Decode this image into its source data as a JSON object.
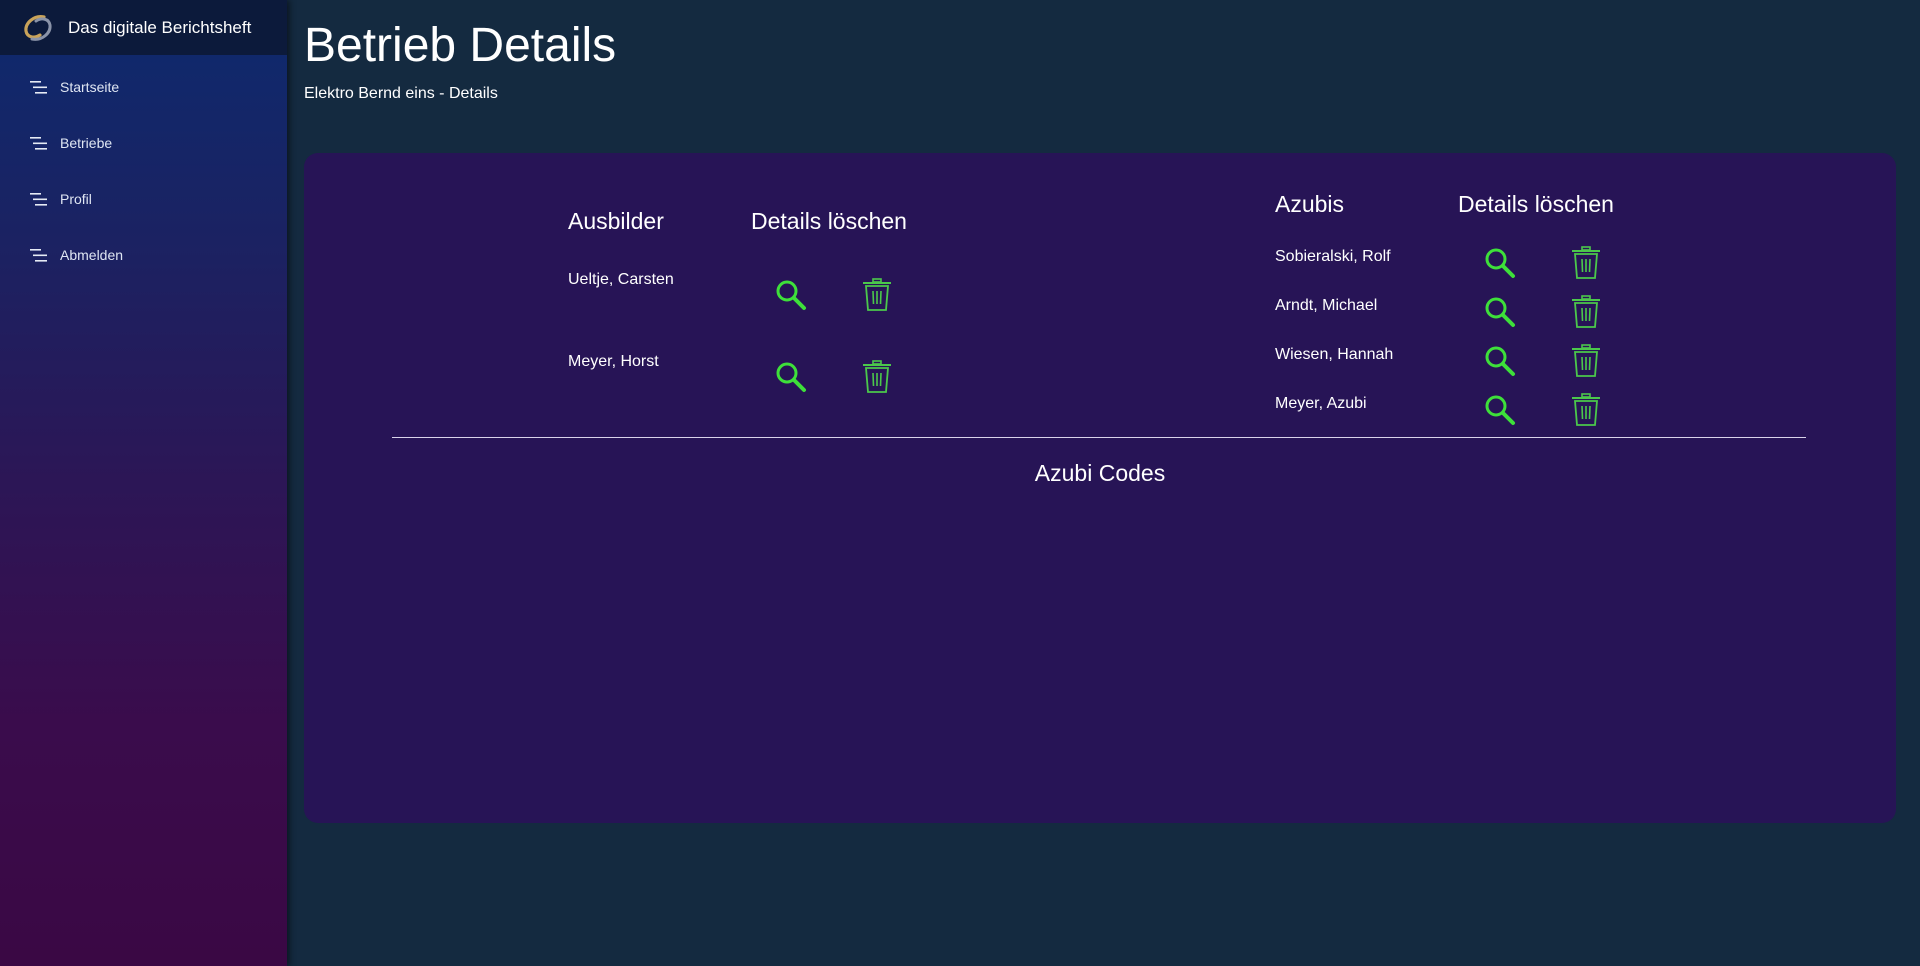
{
  "sidebar": {
    "brand": "Das digitale Berichtsheft",
    "items": [
      {
        "label": "Startseite",
        "icon": "menu-lines-icon"
      },
      {
        "label": "Betriebe",
        "icon": "menu-lines-icon"
      },
      {
        "label": "Profil",
        "icon": "menu-lines-icon"
      },
      {
        "label": "Abmelden",
        "icon": "menu-lines-icon"
      }
    ]
  },
  "header": {
    "title": "Betrieb Details",
    "subtitle": "Elektro Bernd eins - Details"
  },
  "ausbilder": {
    "heading": "Ausbilder",
    "actions_heading": "Details löschen",
    "people": [
      "Ueltje, Carsten",
      "Meyer, Horst"
    ]
  },
  "azubis": {
    "heading": "Azubis",
    "actions_heading": "Details löschen",
    "people": [
      "Sobieralski, Rolf",
      "Arndt, Michael",
      "Wiesen, Hannah",
      "Meyer, Azubi"
    ]
  },
  "codes": {
    "heading": "Azubi Codes"
  },
  "colors": {
    "background": "#142a40",
    "card": "#271456",
    "icon_search": "#3ee03a",
    "icon_trash": "#4bc84b",
    "brand_bar": "#0c1a3b"
  }
}
